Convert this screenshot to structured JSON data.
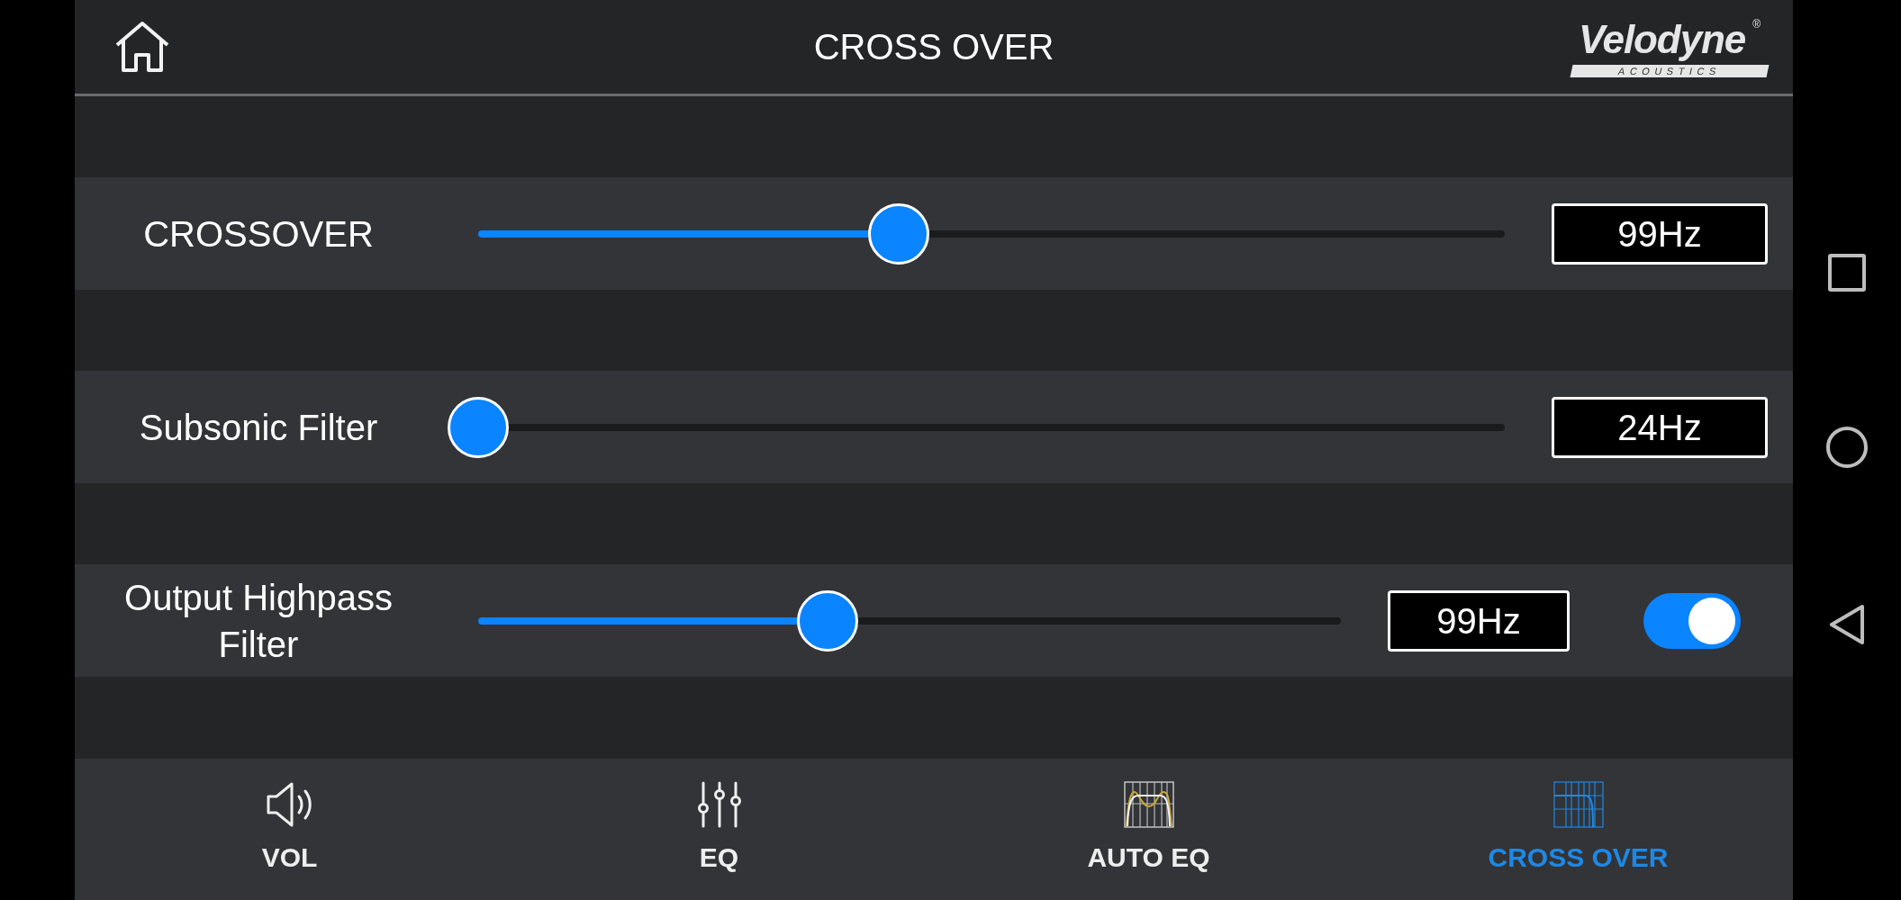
{
  "header": {
    "title": "CROSS OVER",
    "logo": {
      "name": "Velodyne",
      "tagline": "ACOUSTICS",
      "mark": "®"
    }
  },
  "controls": [
    {
      "label": "CROSSOVER",
      "level": 0.41,
      "value": "99Hz"
    },
    {
      "label": "Subsonic Filter",
      "level": 0,
      "value": "24Hz"
    },
    {
      "label": "Output Highpass Filter",
      "level": 0.405,
      "value": "99Hz",
      "toggle": {
        "on": true
      }
    }
  ],
  "nav": [
    {
      "kind": "volume",
      "label": "VOL",
      "selected": false
    },
    {
      "kind": "eq",
      "label": "EQ",
      "selected": false
    },
    {
      "kind": "autoeq",
      "label": "AUTO EQ",
      "selected": false
    },
    {
      "kind": "crossover",
      "label": "CROSS OVER",
      "selected": true
    }
  ]
}
